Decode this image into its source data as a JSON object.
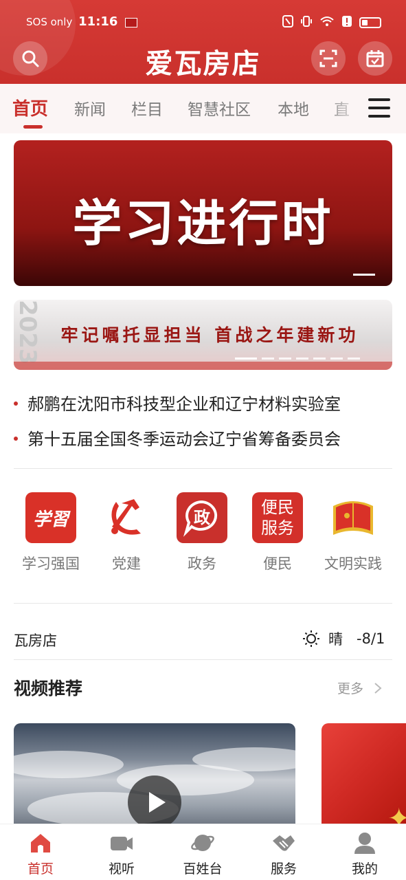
{
  "status_bar": {
    "carrier": "SOS only",
    "time": "11:16"
  },
  "header": {
    "title": "爱瓦房店",
    "accent_color": "#c9302c"
  },
  "tabs": [
    {
      "label": "首页",
      "active": true
    },
    {
      "label": "新闻",
      "active": false
    },
    {
      "label": "栏目",
      "active": false
    },
    {
      "label": "智慧社区",
      "active": false
    },
    {
      "label": "本地",
      "active": false
    },
    {
      "label": "直",
      "active": false
    }
  ],
  "banner": {
    "title": "学习进行时"
  },
  "sub_banner": {
    "year": "2023",
    "slogan": "牢记嘱托显担当  首战之年建新功"
  },
  "headlines": [
    "郝鹏在沈阳市科技型企业和辽宁材料实验室",
    "第十五届全国冬季运动会辽宁省筹备委员会"
  ],
  "shortcuts": [
    {
      "label": "学习强国",
      "icon": "xuexi-qiangguo-icon",
      "glyph": "学習"
    },
    {
      "label": "党建",
      "icon": "party-emblem-icon"
    },
    {
      "label": "政务",
      "icon": "government-affairs-icon",
      "glyph": "政"
    },
    {
      "label": "便民",
      "icon": "convenience-service-icon",
      "glyph_line1": "便民",
      "glyph_line2": "服务"
    },
    {
      "label": "文明实践",
      "icon": "civilization-practice-icon"
    }
  ],
  "weather": {
    "location": "瓦房店",
    "condition": "晴",
    "temperature": "-8/1"
  },
  "video_section": {
    "title": "视频推荐",
    "more_label": "更多"
  },
  "bottom_nav": [
    {
      "label": "首页",
      "icon": "home-icon",
      "active": true
    },
    {
      "label": "视听",
      "icon": "video-camera-icon",
      "active": false
    },
    {
      "label": "百姓台",
      "icon": "planet-icon",
      "active": false
    },
    {
      "label": "服务",
      "icon": "handshake-icon",
      "active": false
    },
    {
      "label": "我的",
      "icon": "user-icon",
      "active": false
    }
  ]
}
